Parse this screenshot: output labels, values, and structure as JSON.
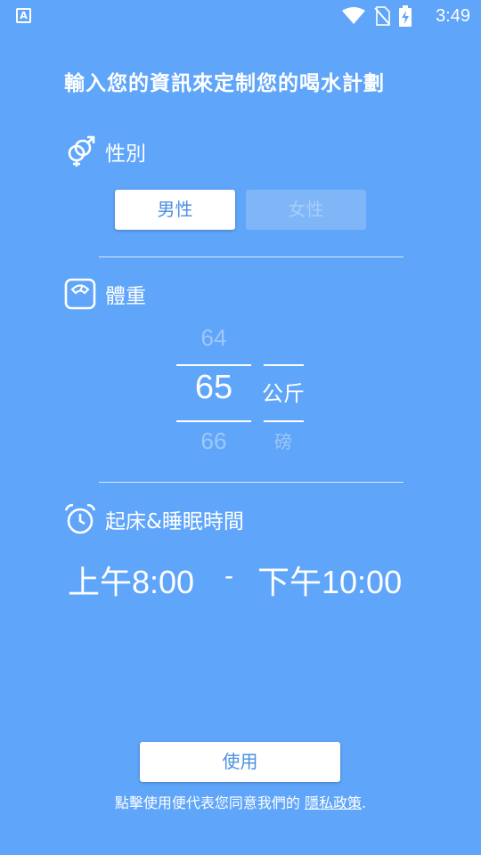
{
  "status_bar": {
    "app_badge": "A",
    "time": "3:49",
    "icons": [
      "wifi-icon",
      "no-sim-icon",
      "battery-charging-icon"
    ]
  },
  "title": "輸入您的資訊來定制您的喝水計劃",
  "gender": {
    "label": "性別",
    "icon": "gender-icon",
    "options": [
      "男性",
      "女性"
    ],
    "selected": "男性"
  },
  "weight": {
    "label": "體重",
    "icon": "scale-icon",
    "values": [
      "64",
      "65",
      "66"
    ],
    "selected": "65",
    "units": [
      "公斤",
      "磅"
    ],
    "selected_unit": "公斤"
  },
  "schedule": {
    "label": "起床&睡眠時間",
    "icon": "alarm-clock-icon",
    "wake_time": "上午8:00",
    "separator": "-",
    "sleep_time": "下午10:00"
  },
  "footer": {
    "use_label": "使用",
    "policy_prefix": "點擊使用便代表您同意我們的 ",
    "policy_link": "隱私政策",
    "policy_suffix": "."
  },
  "colors": {
    "background": "#5fa5f9",
    "accent_text": "#4a90e2",
    "faded": "#9ec8f9"
  }
}
